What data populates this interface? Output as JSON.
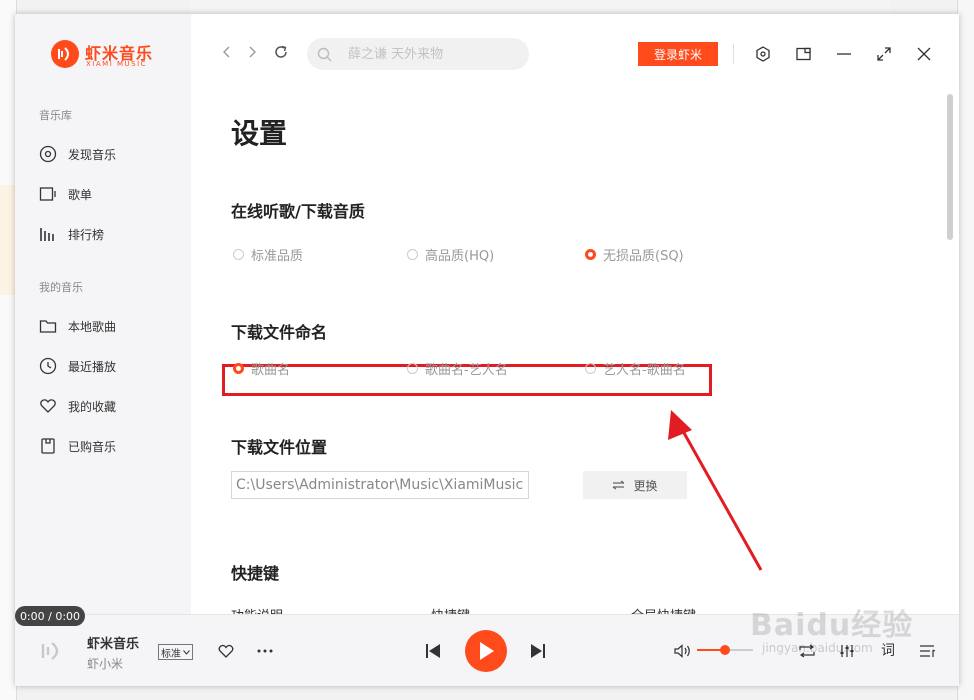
{
  "brand": {
    "name": "虾米音乐",
    "sub": "XIAMI MUSIC",
    "accent": "#ff4a1c"
  },
  "sidebar": {
    "library_label": "音乐库",
    "library_items": [
      {
        "label": "发现音乐",
        "icon": "disc-icon"
      },
      {
        "label": "歌单",
        "icon": "playlist-icon"
      },
      {
        "label": "排行榜",
        "icon": "chart-icon"
      }
    ],
    "mine_label": "我的音乐",
    "mine_items": [
      {
        "label": "本地歌曲",
        "icon": "folder-icon"
      },
      {
        "label": "最近播放",
        "icon": "clock-icon"
      },
      {
        "label": "我的收藏",
        "icon": "heart-icon"
      },
      {
        "label": "已购音乐",
        "icon": "purchase-icon"
      }
    ]
  },
  "search": {
    "placeholder": "薛之谦 天外来物"
  },
  "header": {
    "login_label": "登录虾米"
  },
  "settings": {
    "title": "设置",
    "quality": {
      "label": "在线听歌/下载音质",
      "options": [
        "标准品质",
        "高品质(HQ)",
        "无损品质(SQ)"
      ],
      "selected": "无损品质(SQ)"
    },
    "naming": {
      "label": "下载文件命名",
      "options": [
        "歌曲名",
        "歌曲名-艺人名",
        "艺人名-歌曲名"
      ],
      "selected": "歌曲名"
    },
    "location": {
      "label": "下载文件位置",
      "path": "C:\\Users\\Administrator\\Music\\XiamiMusic",
      "change_label": "更换"
    },
    "hotkeys": {
      "label": "快捷键",
      "columns": [
        "功能说明",
        "快捷键",
        "全局快捷键"
      ]
    }
  },
  "player": {
    "time": "0:00 / 0:00",
    "song": "虾米音乐",
    "artist": "虾小米",
    "quality": "标准",
    "volume": 0.5,
    "lyric_label": "词"
  },
  "watermark": {
    "logo": "Baidu经验",
    "url": "jingyan.baidu.com"
  }
}
